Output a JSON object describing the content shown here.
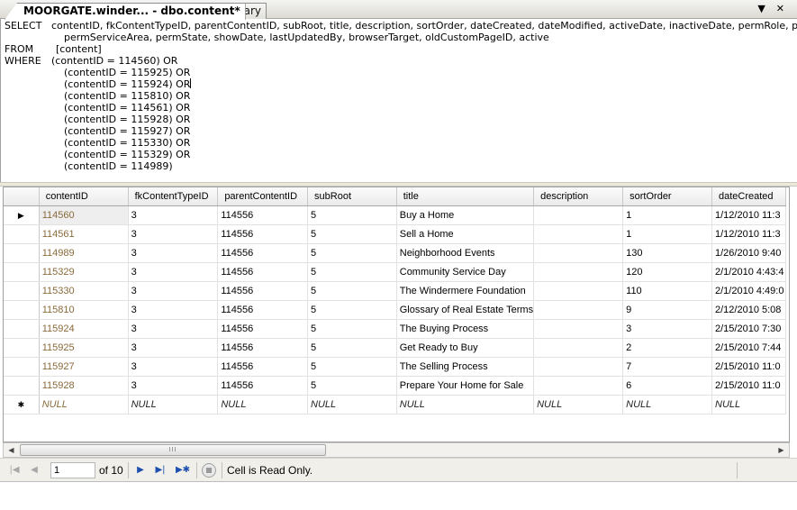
{
  "tabs": {
    "active": "MOORGATE.winder... - dbo.content*",
    "inactive": "Summary",
    "controls": {
      "dropdown": "▼",
      "close": "✕"
    }
  },
  "sql": {
    "select_kw": "SELECT",
    "select_cols_1": "contentID, fkContentTypeID, parentContentID, subRoot, title, description, sortOrder, dateCreated, dateModified, activeDate, inactiveDate, permRole, permMLS,",
    "select_cols_2": "permServiceArea, permState, showDate, lastUpdatedBy, browserTarget, oldCustomPageID, active",
    "from_kw": "FROM",
    "from_table": "[content]",
    "where_kw": "WHERE",
    "where_first": "(contentID = 114560) OR",
    "where_lines": [
      "(contentID = 115925) OR",
      "(contentID = 115924) OR",
      "(contentID = 115810) OR",
      "(contentID = 114561) OR",
      "(contentID = 115928) OR",
      "(contentID = 115927) OR",
      "(contentID = 115330) OR",
      "(contentID = 115329) OR",
      "(contentID = 114989)"
    ]
  },
  "grid": {
    "columns": [
      "contentID",
      "fkContentTypeID",
      "parentContentID",
      "subRoot",
      "title",
      "description",
      "sortOrder",
      "dateCreated"
    ],
    "rows": [
      [
        "114560",
        "3",
        "114556",
        "5",
        "Buy a Home",
        "",
        "1",
        "1/12/2010 11:3"
      ],
      [
        "114561",
        "3",
        "114556",
        "5",
        "Sell a Home",
        "",
        "1",
        "1/12/2010 11:3"
      ],
      [
        "114989",
        "3",
        "114556",
        "5",
        "Neighborhood Events",
        "",
        "130",
        "1/26/2010 9:40"
      ],
      [
        "115329",
        "3",
        "114556",
        "5",
        "Community Service Day",
        "",
        "120",
        "2/1/2010 4:43:4"
      ],
      [
        "115330",
        "3",
        "114556",
        "5",
        "The Windermere Foundation",
        "",
        "110",
        "2/1/2010 4:49:0"
      ],
      [
        "115810",
        "3",
        "114556",
        "5",
        "Glossary of Real Estate Terms",
        "",
        "9",
        "2/12/2010 5:08"
      ],
      [
        "115924",
        "3",
        "114556",
        "5",
        "The Buying Process",
        "",
        "3",
        "2/15/2010 7:30"
      ],
      [
        "115925",
        "3",
        "114556",
        "5",
        "Get Ready to Buy",
        "",
        "2",
        "2/15/2010 7:44"
      ],
      [
        "115927",
        "3",
        "114556",
        "5",
        "The Selling Process",
        "",
        "7",
        "2/15/2010 11:0"
      ],
      [
        "115928",
        "3",
        "114556",
        "5",
        "Prepare Your Home for Sale",
        "",
        "6",
        "2/15/2010 11:0"
      ]
    ],
    "null_row": [
      "NULL",
      "NULL",
      "NULL",
      "NULL",
      "NULL",
      "NULL",
      "NULL",
      "NULL"
    ],
    "current_marker": "▶",
    "new_marker": "✱"
  },
  "scrollbar": {
    "left": "◀",
    "right": "▶",
    "grip": "III"
  },
  "navigator": {
    "first": "|◀",
    "prev": "◀",
    "page_value": "1",
    "of_text": "of 10",
    "next": "▶",
    "last": "▶|",
    "new": "▶✱",
    "status": "Cell is Read Only."
  }
}
